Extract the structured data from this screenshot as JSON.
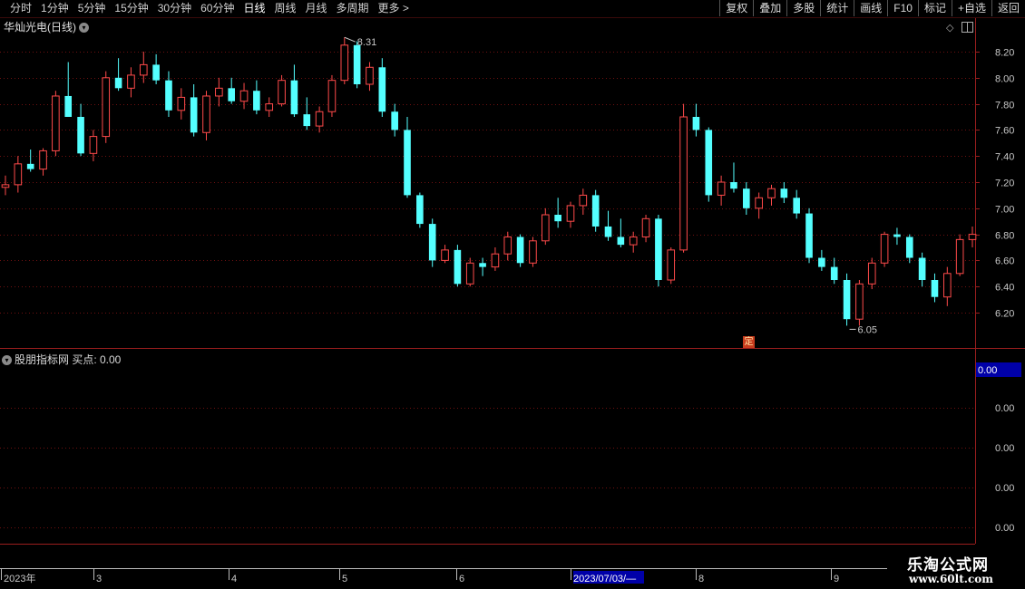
{
  "toolbar": {
    "items": [
      "分时",
      "1分钟",
      "5分钟",
      "15分钟",
      "30分钟",
      "60分钟",
      "日线",
      "周线",
      "月线",
      "多周期",
      "更多 >"
    ],
    "active_index": 6,
    "right_buttons": [
      "复权",
      "叠加",
      "多股",
      "统计",
      "画线",
      "F10",
      "标记",
      "+自选",
      "返回"
    ]
  },
  "chart": {
    "stock_title": "华灿光电(日线)",
    "high_label": "8.31",
    "low_label": "6.05",
    "ding_badge": "定",
    "price_axis": [
      "8.20",
      "8.00",
      "7.80",
      "7.60",
      "7.40",
      "7.20",
      "7.00",
      "6.80",
      "6.60",
      "6.40",
      "6.20"
    ],
    "date_axis": [
      "2023年",
      "3",
      "4",
      "5",
      "6",
      "2023/07/03/—",
      "8",
      "9"
    ],
    "colors": {
      "up": "#ff4a4a",
      "down": "#54ffff",
      "grid": "#6e1010",
      "axis": "#9a1e1e"
    }
  },
  "indicator": {
    "title": "股朋指标网 买点: 0.00",
    "current_value": "0.00",
    "axis": [
      "0.00",
      "0.00",
      "0.00",
      "0.00"
    ]
  },
  "watermark": {
    "line1": "乐淘公式网",
    "line2": "www.60lt.com"
  },
  "chart_data": {
    "type": "candlestick",
    "price_range": [
      6.05,
      8.31
    ],
    "ohlc": [
      [
        7.16,
        7.25,
        7.1,
        7.18
      ],
      [
        7.18,
        7.4,
        7.12,
        7.34
      ],
      [
        7.34,
        7.45,
        7.28,
        7.3
      ],
      [
        7.3,
        7.46,
        7.25,
        7.44
      ],
      [
        7.44,
        7.9,
        7.4,
        7.86
      ],
      [
        7.86,
        8.12,
        7.7,
        7.7
      ],
      [
        7.7,
        7.8,
        7.4,
        7.42
      ],
      [
        7.42,
        7.6,
        7.36,
        7.55
      ],
      [
        7.55,
        8.05,
        7.5,
        8.0
      ],
      [
        8.0,
        8.15,
        7.9,
        7.92
      ],
      [
        7.92,
        8.08,
        7.85,
        8.02
      ],
      [
        8.02,
        8.2,
        7.96,
        8.1
      ],
      [
        8.1,
        8.18,
        7.95,
        7.98
      ],
      [
        7.98,
        8.05,
        7.7,
        7.75
      ],
      [
        7.75,
        7.92,
        7.68,
        7.85
      ],
      [
        7.85,
        7.95,
        7.55,
        7.58
      ],
      [
        7.58,
        7.9,
        7.52,
        7.86
      ],
      [
        7.86,
        8.0,
        7.78,
        7.92
      ],
      [
        7.92,
        8.0,
        7.8,
        7.82
      ],
      [
        7.82,
        7.96,
        7.76,
        7.9
      ],
      [
        7.9,
        7.98,
        7.72,
        7.75
      ],
      [
        7.75,
        7.85,
        7.7,
        7.8
      ],
      [
        7.8,
        8.02,
        7.78,
        7.98
      ],
      [
        7.98,
        8.1,
        7.7,
        7.72
      ],
      [
        7.72,
        7.85,
        7.6,
        7.63
      ],
      [
        7.63,
        7.78,
        7.58,
        7.74
      ],
      [
        7.74,
        8.02,
        7.7,
        7.98
      ],
      [
        7.98,
        8.31,
        7.95,
        8.25
      ],
      [
        8.25,
        8.28,
        7.92,
        7.95
      ],
      [
        7.95,
        8.12,
        7.9,
        8.08
      ],
      [
        8.08,
        8.15,
        7.7,
        7.74
      ],
      [
        7.74,
        7.8,
        7.55,
        7.6
      ],
      [
        7.6,
        7.7,
        7.08,
        7.1
      ],
      [
        7.1,
        7.12,
        6.85,
        6.88
      ],
      [
        6.88,
        6.92,
        6.55,
        6.6
      ],
      [
        6.6,
        6.72,
        6.58,
        6.68
      ],
      [
        6.68,
        6.72,
        6.4,
        6.42
      ],
      [
        6.42,
        6.62,
        6.4,
        6.58
      ],
      [
        6.58,
        6.62,
        6.48,
        6.55
      ],
      [
        6.55,
        6.7,
        6.52,
        6.65
      ],
      [
        6.65,
        6.82,
        6.6,
        6.78
      ],
      [
        6.78,
        6.8,
        6.55,
        6.58
      ],
      [
        6.58,
        6.78,
        6.55,
        6.75
      ],
      [
        6.75,
        7.0,
        6.72,
        6.95
      ],
      [
        6.95,
        7.08,
        6.85,
        6.9
      ],
      [
        6.9,
        7.05,
        6.85,
        7.02
      ],
      [
        7.02,
        7.15,
        6.95,
        7.1
      ],
      [
        7.1,
        7.14,
        6.82,
        6.86
      ],
      [
        6.86,
        6.98,
        6.75,
        6.78
      ],
      [
        6.78,
        6.92,
        6.7,
        6.72
      ],
      [
        6.72,
        6.82,
        6.66,
        6.78
      ],
      [
        6.78,
        6.95,
        6.74,
        6.92
      ],
      [
        6.92,
        6.95,
        6.4,
        6.45
      ],
      [
        6.45,
        6.7,
        6.42,
        6.68
      ],
      [
        6.68,
        7.8,
        6.66,
        7.7
      ],
      [
        7.7,
        7.8,
        7.55,
        7.6
      ],
      [
        7.6,
        7.62,
        7.05,
        7.1
      ],
      [
        7.1,
        7.25,
        7.02,
        7.2
      ],
      [
        7.2,
        7.35,
        7.12,
        7.15
      ],
      [
        7.15,
        7.2,
        6.95,
        7.0
      ],
      [
        7.0,
        7.12,
        6.92,
        7.08
      ],
      [
        7.08,
        7.18,
        7.02,
        7.15
      ],
      [
        7.15,
        7.2,
        7.04,
        7.08
      ],
      [
        7.08,
        7.14,
        6.92,
        6.96
      ],
      [
        6.96,
        7.0,
        6.58,
        6.62
      ],
      [
        6.62,
        6.68,
        6.52,
        6.55
      ],
      [
        6.55,
        6.62,
        6.42,
        6.45
      ],
      [
        6.45,
        6.5,
        6.1,
        6.15
      ],
      [
        6.15,
        6.45,
        6.1,
        6.42
      ],
      [
        6.42,
        6.62,
        6.38,
        6.58
      ],
      [
        6.58,
        6.82,
        6.55,
        6.8
      ],
      [
        6.8,
        6.85,
        6.72,
        6.78
      ],
      [
        6.78,
        6.8,
        6.58,
        6.62
      ],
      [
        6.62,
        6.66,
        6.4,
        6.45
      ],
      [
        6.45,
        6.5,
        6.28,
        6.32
      ],
      [
        6.32,
        6.55,
        6.25,
        6.5
      ],
      [
        6.5,
        6.8,
        6.48,
        6.76
      ],
      [
        6.76,
        6.86,
        6.7,
        6.8
      ]
    ],
    "indicator_series": {
      "name": "买点",
      "value": 0.0
    }
  }
}
